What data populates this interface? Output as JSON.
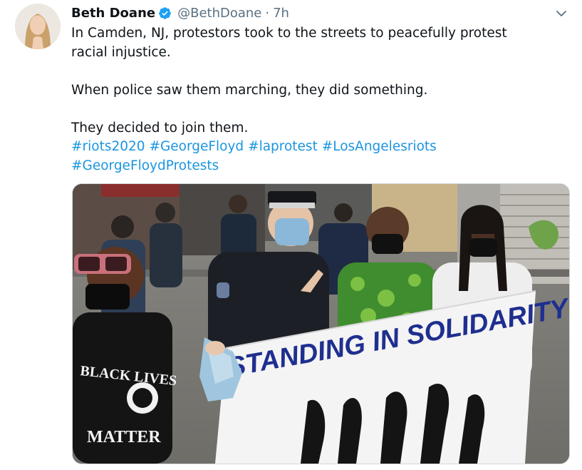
{
  "tweet": {
    "author_name": "Beth Doane",
    "handle": "@BethDoane",
    "separator": "·",
    "time": "7h",
    "text_lines": [
      "In Camden, NJ, protestors took to the streets to peacefully protest",
      "racial injustice.",
      "When police saw them marching, they did something.",
      "They decided to join them."
    ],
    "hashtags": [
      "#riots2020",
      "#GeorgeFloyd",
      "#laprotest",
      "#LosAngelesriots",
      "#GeorgeFloydProtests"
    ],
    "media": {
      "banner_text": "STANDING IN SOLIDARITY",
      "shirt_text_1": "BLACK LIVES",
      "shirt_text_2": "MATTER"
    }
  },
  "colors": {
    "link": "#1b95e0",
    "secondary_text": "#5b7083",
    "verified": "#1da1f2"
  },
  "icons": [
    "verified-badge-icon",
    "chevron-down-icon"
  ]
}
